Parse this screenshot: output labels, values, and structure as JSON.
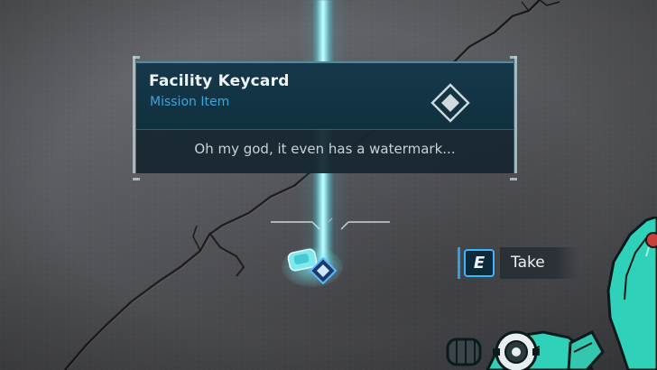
{
  "tooltip": {
    "title": "Facility Keycard",
    "subtitle": "Mission Item",
    "description": "Oh my god, it even has a watermark...",
    "icon": "diamond-waypoint-icon",
    "subtitle_color": "#3fa4d8"
  },
  "prompt": {
    "key": "E",
    "action": "Take",
    "key_color": "#3ab6ff"
  },
  "world": {
    "item_icon": "keycard-item-icon",
    "beam_color": "#9ff6ff",
    "character_color": "#2fd1b8"
  }
}
